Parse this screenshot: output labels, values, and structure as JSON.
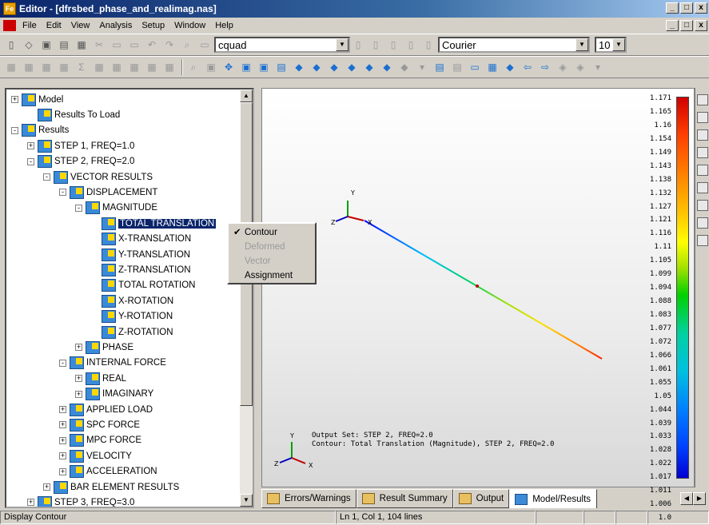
{
  "window": {
    "title": "Editor - [dfrsbed_phase_and_realimag.nas]",
    "controls": [
      "_",
      "□",
      "x"
    ]
  },
  "menu": [
    "File",
    "Edit",
    "View",
    "Analysis",
    "Setup",
    "Window",
    "Help"
  ],
  "toolbar": {
    "element_combo": "cquad",
    "font_combo": "Courier",
    "size_combo": "10"
  },
  "tree": [
    {
      "label": "Model",
      "indent": 0,
      "exp": "+",
      "icon": true
    },
    {
      "label": "Results To Load",
      "indent": 1,
      "exp": "",
      "icon": true
    },
    {
      "label": "Results",
      "indent": 0,
      "exp": "-",
      "icon": true
    },
    {
      "label": "STEP 1, FREQ=1.0",
      "indent": 1,
      "exp": "+",
      "icon": true
    },
    {
      "label": "STEP 2, FREQ=2.0",
      "indent": 1,
      "exp": "-",
      "icon": true
    },
    {
      "label": "VECTOR RESULTS",
      "indent": 2,
      "exp": "-",
      "icon": true
    },
    {
      "label": "DISPLACEMENT",
      "indent": 3,
      "exp": "-",
      "icon": true
    },
    {
      "label": "MAGNITUDE",
      "indent": 4,
      "exp": "-",
      "icon": true
    },
    {
      "label": "TOTAL TRANSLATION",
      "indent": 5,
      "exp": "",
      "icon": true,
      "selected": true
    },
    {
      "label": "X-TRANSLATION",
      "indent": 5,
      "exp": "",
      "icon": true
    },
    {
      "label": "Y-TRANSLATION",
      "indent": 5,
      "exp": "",
      "icon": true
    },
    {
      "label": "Z-TRANSLATION",
      "indent": 5,
      "exp": "",
      "icon": true
    },
    {
      "label": "TOTAL ROTATION",
      "indent": 5,
      "exp": "",
      "icon": true
    },
    {
      "label": "X-ROTATION",
      "indent": 5,
      "exp": "",
      "icon": true
    },
    {
      "label": "Y-ROTATION",
      "indent": 5,
      "exp": "",
      "icon": true
    },
    {
      "label": "Z-ROTATION",
      "indent": 5,
      "exp": "",
      "icon": true
    },
    {
      "label": "PHASE",
      "indent": 4,
      "exp": "+",
      "icon": true
    },
    {
      "label": "INTERNAL FORCE",
      "indent": 3,
      "exp": "-",
      "icon": true
    },
    {
      "label": "REAL",
      "indent": 4,
      "exp": "+",
      "icon": true
    },
    {
      "label": "IMAGINARY",
      "indent": 4,
      "exp": "+",
      "icon": true
    },
    {
      "label": "APPLIED LOAD",
      "indent": 3,
      "exp": "+",
      "icon": true
    },
    {
      "label": "SPC FORCE",
      "indent": 3,
      "exp": "+",
      "icon": true
    },
    {
      "label": "MPC FORCE",
      "indent": 3,
      "exp": "+",
      "icon": true
    },
    {
      "label": "VELOCITY",
      "indent": 3,
      "exp": "+",
      "icon": true
    },
    {
      "label": "ACCELERATION",
      "indent": 3,
      "exp": "+",
      "icon": true
    },
    {
      "label": "BAR ELEMENT RESULTS",
      "indent": 2,
      "exp": "+",
      "icon": true
    },
    {
      "label": "STEP 3, FREQ=3.0",
      "indent": 1,
      "exp": "+",
      "icon": true
    }
  ],
  "context_menu": [
    {
      "label": "Contour",
      "checked": true,
      "disabled": false
    },
    {
      "label": "Deformed",
      "checked": false,
      "disabled": true
    },
    {
      "label": "Vector",
      "checked": false,
      "disabled": true
    },
    {
      "label": "Assignment",
      "checked": false,
      "disabled": false
    }
  ],
  "viewport": {
    "axis_labels": {
      "y": "Y",
      "z": "Z",
      "x": "X"
    },
    "output_line1": "Output Set: STEP 2, FREQ=2.0",
    "output_line2": "Contour: Total Translation (Magnitude), STEP 2, FREQ=2.0",
    "legend_values": [
      "1.171",
      "1.165",
      "1.16",
      "1.154",
      "1.149",
      "1.143",
      "1.138",
      "1.132",
      "1.127",
      "1.121",
      "1.116",
      "1.11",
      "1.105",
      "1.099",
      "1.094",
      "1.088",
      "1.083",
      "1.077",
      "1.072",
      "1.066",
      "1.061",
      "1.055",
      "1.05",
      "1.044",
      "1.039",
      "1.033",
      "1.028",
      "1.022",
      "1.017",
      "1.011",
      "1.006",
      "1.0"
    ]
  },
  "tabs": [
    {
      "label": "Errors/Warnings",
      "active": false
    },
    {
      "label": "Result Summary",
      "active": false
    },
    {
      "label": "Output",
      "active": false
    },
    {
      "label": "Model/Results",
      "active": true
    }
  ],
  "status": {
    "left": "Display Contour",
    "middle": "Ln 1, Col 1, 104 lines"
  }
}
